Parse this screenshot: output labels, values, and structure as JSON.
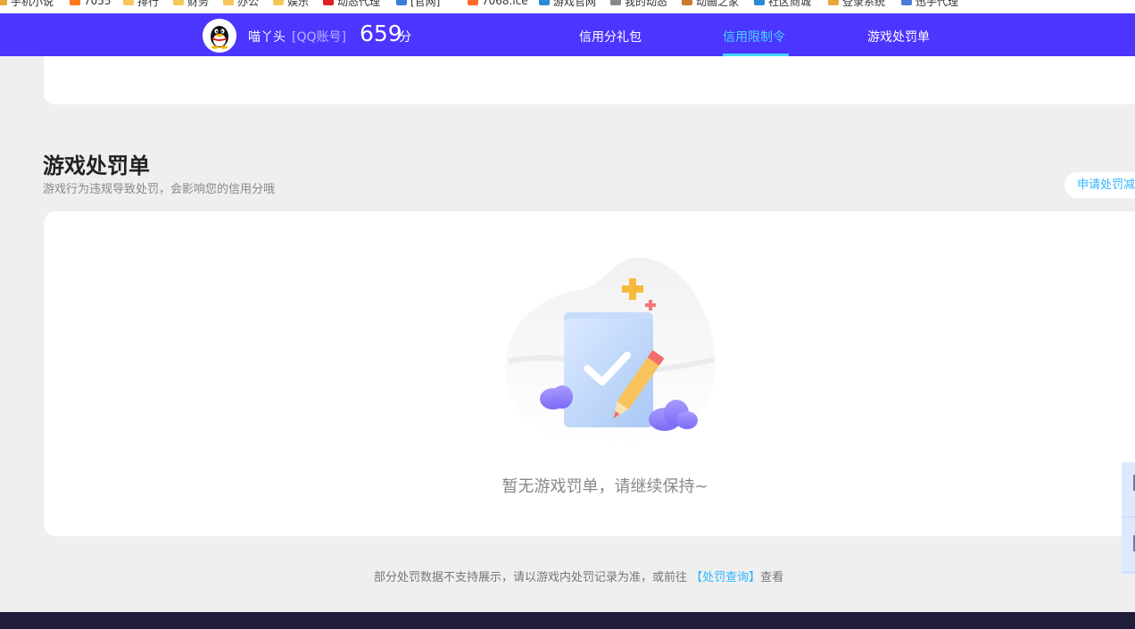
{
  "bookmarks": [
    {
      "label": "手机小说",
      "color": "#e8a53a"
    },
    {
      "label": "7055",
      "color": "#ff7a1a"
    },
    {
      "label": "排行",
      "color": "#f5c658"
    },
    {
      "label": "财务",
      "color": "#f5c658"
    },
    {
      "label": "办公",
      "color": "#f5c658"
    },
    {
      "label": "娱乐",
      "color": "#f5c658"
    },
    {
      "label": "动态代理",
      "color": "#e02020"
    },
    {
      "label": "[官网]",
      "color": "#3a7bd5"
    },
    {
      "label": "7068.ice",
      "color": "#ff6a2a"
    },
    {
      "label": "游戏官网",
      "color": "#2a8ad5"
    },
    {
      "label": "我的动态",
      "color": "#888888"
    },
    {
      "label": "动画之家",
      "color": "#c97a2a"
    },
    {
      "label": "社区商城",
      "color": "#2a8ad5"
    },
    {
      "label": "登录系统",
      "color": "#e8a53a"
    },
    {
      "label": "迅手代理",
      "color": "#4a7bd5"
    }
  ],
  "header": {
    "user_name": "喵丫头",
    "account_type": "[QQ账号]",
    "score": "659",
    "score_unit": "分",
    "tabs": [
      {
        "label": "信用分礼包",
        "active": false
      },
      {
        "label": "信用限制令",
        "active": true
      },
      {
        "label": "游戏处罚单",
        "active": false
      }
    ]
  },
  "section": {
    "title": "游戏处罚单",
    "subtitle": "游戏行为违规导致处罚，会影响您的信用分哦",
    "appeal_button": "申请处罚减免"
  },
  "empty_state": {
    "text": "暂无游戏罚单，请继续保持~"
  },
  "footer": {
    "note_prefix": "部分处罚数据不支持展示，请以游戏内处罚记录为准，或前往",
    "link": "【处罚查询】",
    "note_suffix": "查看"
  },
  "colors": {
    "nav_bg": "#4c35ff",
    "accent": "#46d6ff",
    "link": "#2fb6ff"
  }
}
